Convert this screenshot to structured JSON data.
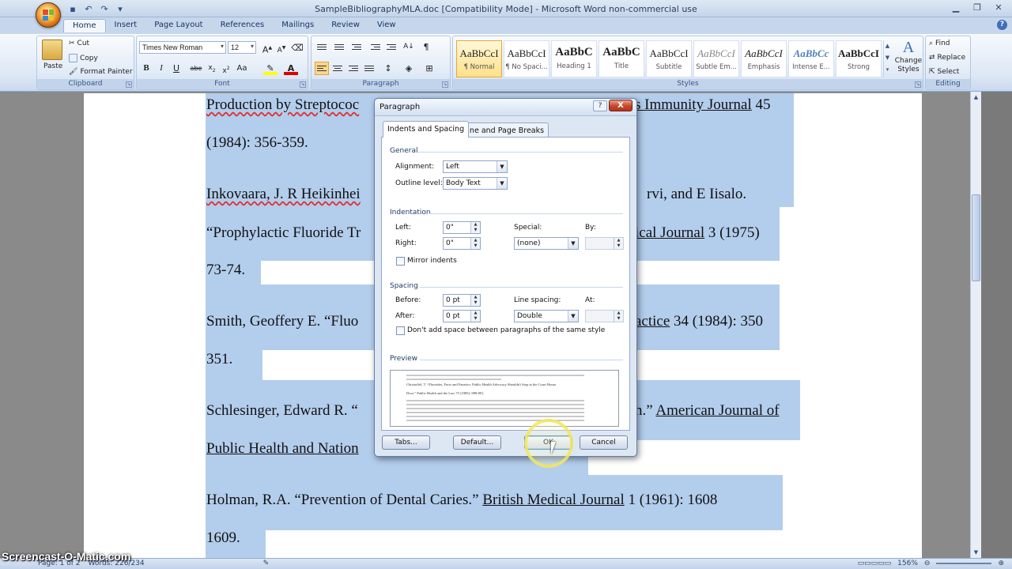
{
  "window": {
    "title": "SampleBibliographyMLA.doc [Compatibility Mode] - Microsoft Word non-commercial use"
  },
  "ribbon": {
    "tabs": [
      "Home",
      "Insert",
      "Page Layout",
      "References",
      "Mailings",
      "Review",
      "View"
    ],
    "active_tab": "Home",
    "clipboard": {
      "label": "Clipboard",
      "paste": "Paste",
      "cut": "Cut",
      "copy": "Copy",
      "format_painter": "Format Painter"
    },
    "font": {
      "label": "Font",
      "name": "Times New Roman",
      "size": "12"
    },
    "paragraph": {
      "label": "Paragraph"
    },
    "styles": {
      "label": "Styles",
      "items": [
        {
          "sample": "AaBbCcI",
          "name": "¶ Normal"
        },
        {
          "sample": "AaBbCcI",
          "name": "¶ No Spaci..."
        },
        {
          "sample": "AaBbC",
          "name": "Heading 1"
        },
        {
          "sample": "AaBbC",
          "name": "Title"
        },
        {
          "sample": "AaBbCcI",
          "name": "Subtitle"
        },
        {
          "sample": "AaBbCcI",
          "name": "Subtle Em..."
        },
        {
          "sample": "AaBbCcI",
          "name": "Emphasis"
        },
        {
          "sample": "AaBbCc",
          "name": "Intense E..."
        },
        {
          "sample": "AaBbCcI",
          "name": "Strong"
        }
      ],
      "change_styles_line1": "Change",
      "change_styles_line2": "Styles"
    },
    "editing": {
      "label": "Editing",
      "find": "Find",
      "replace": "Replace",
      "select": "Select"
    }
  },
  "document": {
    "lines": [
      "Production by Streptococ",
      "s Immunity Journal",
      "45",
      "(1984): 356-359.",
      "Inkovaara, J. R Heikinhei",
      "rvi, and E Iisalo.",
      "“Prophylactic Fluoride Tr",
      "ical Journal",
      "3 (1975)",
      "73-74.",
      "Smith, Geoffery E.  “Fluo",
      "actice",
      "34 (1984): 350",
      "351.",
      "Schlesinger, Edward R.  “",
      "n.”",
      "American Journal of",
      "Public Health and Nation",
      "Holman, R.A.  “Prevention of Dental Caries.”",
      "British Medical Journal",
      "1 (1961): 1608",
      "1609."
    ]
  },
  "dialog": {
    "title": "Paragraph",
    "help": "?",
    "close": "X",
    "tabs": [
      "Indents and Spacing",
      "Line and Page Breaks"
    ],
    "general": {
      "label": "General",
      "alignment_label": "Alignment:",
      "alignment_value": "Left",
      "outline_label": "Outline level:",
      "outline_value": "Body Text"
    },
    "indentation": {
      "label": "Indentation",
      "left_label": "Left:",
      "left_value": "0\"",
      "right_label": "Right:",
      "right_value": "0\"",
      "special_label": "Special:",
      "special_value": "(none)",
      "by_label": "By:",
      "mirror_label": "Mirror indents"
    },
    "spacing": {
      "label": "Spacing",
      "before_label": "Before:",
      "before_value": "0 pt",
      "after_label": "After:",
      "after_value": "0 pt",
      "line_spacing_label": "Line spacing:",
      "line_spacing_value": "Double",
      "at_label": "At:",
      "dont_add_label": "Don't add space between paragraphs of the same style"
    },
    "preview": {
      "label": "Preview",
      "sample_line1": "Christoffel, T.  “Fluorides, Facts and Fanatics:  Public Health Advocacy Shouldn't Stop at the Court House",
      "sample_line2": "Door.”  Public Health and the Law 75 (1985):  888-891."
    },
    "buttons": {
      "tabs": "Tabs...",
      "default": "Default...",
      "ok": "OK",
      "cancel": "Cancel"
    }
  },
  "statusbar": {
    "page": "Page: 1 of 2",
    "words": "Words: 226/234",
    "zoom": "156%"
  },
  "watermark": "Screencast-O-Matic.com",
  "colors": {
    "selection": "#b3cdec",
    "ribbon": "#dce7f5",
    "accent": "#e7a932"
  }
}
